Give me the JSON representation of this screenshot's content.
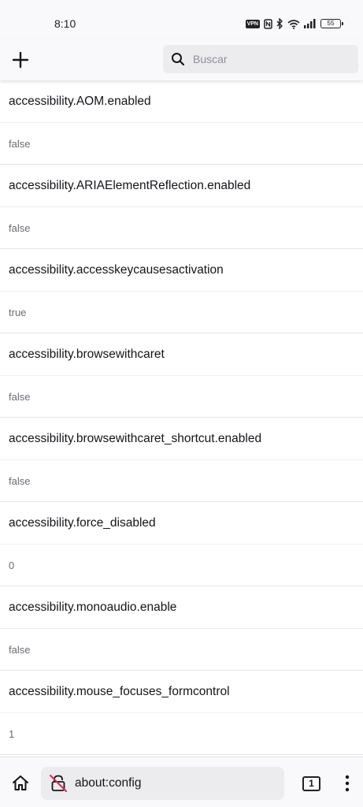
{
  "status_bar": {
    "time": "8:10",
    "vpn_label": "VPN",
    "battery_level": "55"
  },
  "toolbar": {
    "search_placeholder": "Buscar"
  },
  "preferences": [
    {
      "name": "accessibility.AOM.enabled",
      "value": "false"
    },
    {
      "name": "accessibility.ARIAElementReflection.enabled",
      "value": "false"
    },
    {
      "name": "accessibility.accesskeycausesactivation",
      "value": "true"
    },
    {
      "name": "accessibility.browsewithcaret",
      "value": "false"
    },
    {
      "name": "accessibility.browsewithcaret_shortcut.enabled",
      "value": "false"
    },
    {
      "name": "accessibility.force_disabled",
      "value": "0"
    },
    {
      "name": "accessibility.monoaudio.enable",
      "value": "false"
    },
    {
      "name": "accessibility.mouse_focuses_formcontrol",
      "value": "1"
    }
  ],
  "bottom_bar": {
    "url": "about:config",
    "tab_count": "1"
  },
  "icons": {
    "add": "plus-icon",
    "search": "search-icon",
    "home": "home-icon",
    "page_security": "broken-lock-icon",
    "tabs": "tabs-counter-icon",
    "menu": "kebab-menu-icon"
  },
  "colors": {
    "accent_alert": "#e22850",
    "chrome_bg": "#f9f9fb",
    "field_bg": "#ececef"
  }
}
